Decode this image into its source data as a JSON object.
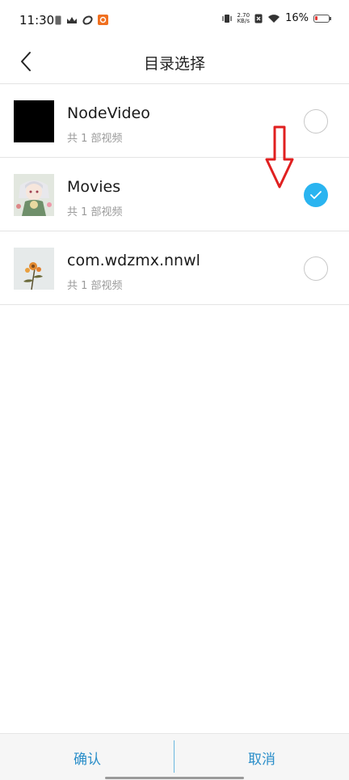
{
  "status_bar": {
    "time": "11:30",
    "net_speed_value": "2.70",
    "net_speed_unit": "KB/s",
    "battery_percent": "16%",
    "battery_level": 0.16,
    "battery_color": "#e53935"
  },
  "header": {
    "title": "目录选择",
    "back_icon": "chevron-left-icon"
  },
  "folders": [
    {
      "name": "NodeVideo",
      "count": "共 1 部视频",
      "selected": false,
      "thumb": "black"
    },
    {
      "name": "Movies",
      "count": "共 1 部视频",
      "selected": true,
      "thumb": "anime-girl"
    },
    {
      "name": "com.wdzmx.nnwl",
      "count": "共 1 部视频",
      "selected": false,
      "thumb": "flower"
    }
  ],
  "bottom_bar": {
    "confirm_label": "确认",
    "cancel_label": "取消",
    "accent_color": "#2a8ec9"
  },
  "colors": {
    "selected_radio": "#2ab4f0",
    "annotation_arrow": "#e02020"
  }
}
